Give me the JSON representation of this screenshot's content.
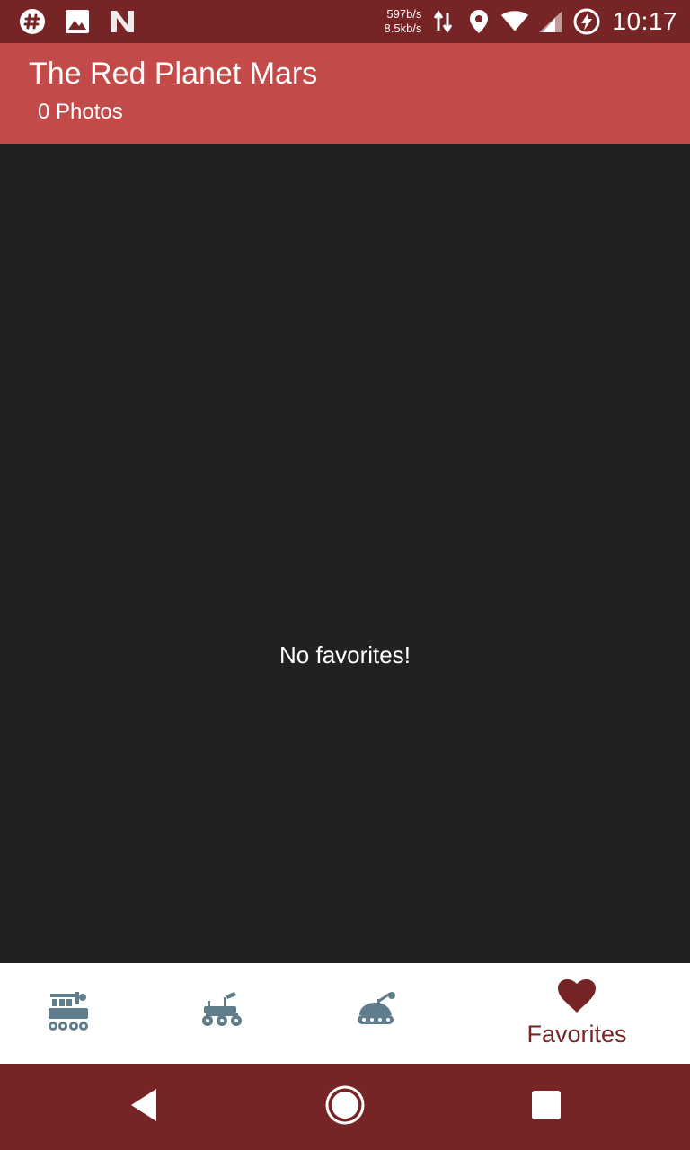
{
  "status_bar": {
    "icons_left": [
      "slack-icon",
      "image-icon",
      "n-logo-icon"
    ],
    "upload_speed": "597b/s",
    "download_speed": "8.5kb/s",
    "icons_right": [
      "data-transfer-icon",
      "location-icon",
      "wifi-icon",
      "signal-icon",
      "battery-saver-icon"
    ],
    "time": "10:17"
  },
  "app_bar": {
    "title": "The Red Planet Mars",
    "subtitle": "0 Photos",
    "color": "#C24A48"
  },
  "content": {
    "empty_message": "No favorites!",
    "background": "#212121"
  },
  "bottom_nav": {
    "items": [
      {
        "icon": "curiosity-rover-icon",
        "label": ""
      },
      {
        "icon": "opportunity-rover-icon",
        "label": ""
      },
      {
        "icon": "spirit-rover-icon",
        "label": ""
      },
      {
        "icon": "heart-icon",
        "label": "Favorites",
        "selected": true
      }
    ],
    "active_color": "#772426",
    "inactive_color": "#607D8B"
  },
  "system_nav": {
    "buttons": [
      "back-icon",
      "home-icon",
      "recents-icon"
    ],
    "color": "#772426"
  }
}
